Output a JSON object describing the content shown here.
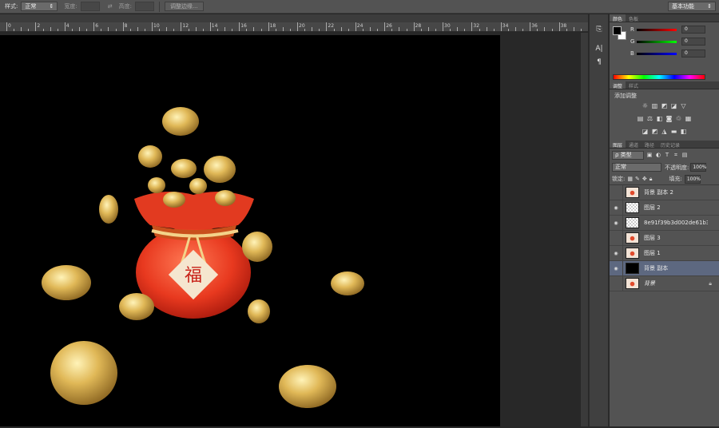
{
  "options_bar": {
    "style_label": "样式:",
    "style_value": "正常",
    "width_label": "宽度:",
    "height_label": "高度:",
    "refine_edge_button": "调整边缘...",
    "workspace": "基本功能"
  },
  "ruler": {
    "labels": [
      "0",
      "2",
      "4",
      "6",
      "8",
      "10",
      "12",
      "14",
      "16",
      "18",
      "20",
      "22",
      "24",
      "26",
      "28",
      "30",
      "32",
      "34",
      "36",
      "38"
    ]
  },
  "mini_panel": {
    "icons": [
      "history-icon",
      "character-icon",
      "paragraph-icon"
    ]
  },
  "color_panel": {
    "tabs": [
      "颜色",
      "色板"
    ],
    "channels": [
      {
        "label": "R",
        "value": "0",
        "color": "#d02020"
      },
      {
        "label": "G",
        "value": "0",
        "color": "#20b040"
      },
      {
        "label": "B",
        "value": "0",
        "color": "#2040d0"
      }
    ],
    "foreground": "#000000",
    "background": "#ffffff"
  },
  "adjustments_panel": {
    "tabs": [
      "调整",
      "样式"
    ],
    "title": "添加调整"
  },
  "layers_panel": {
    "tabs": [
      "图层",
      "通道",
      "路径",
      "历史记录"
    ],
    "filter_kind": "ρ 类型",
    "blend_mode": "正常",
    "opacity_label": "不透明度:",
    "opacity_value": "100%",
    "lock_label": "锁定:",
    "fill_label": "填充:",
    "fill_value": "100%",
    "layers": [
      {
        "name": "背景 副本 2",
        "visible": false,
        "thumb": "img"
      },
      {
        "name": "图层 2",
        "visible": true,
        "thumb": "checker"
      },
      {
        "name": "8e91f39b3d002de61b3ff...",
        "visible": true,
        "thumb": "checker"
      },
      {
        "name": "图层 3",
        "visible": false,
        "thumb": "img"
      },
      {
        "name": "图层 1",
        "visible": true,
        "thumb": "img"
      },
      {
        "name": "背景 副本",
        "visible": true,
        "thumb": "black",
        "active": true
      },
      {
        "name": "背景",
        "visible": false,
        "thumb": "img",
        "locked": true
      }
    ]
  }
}
